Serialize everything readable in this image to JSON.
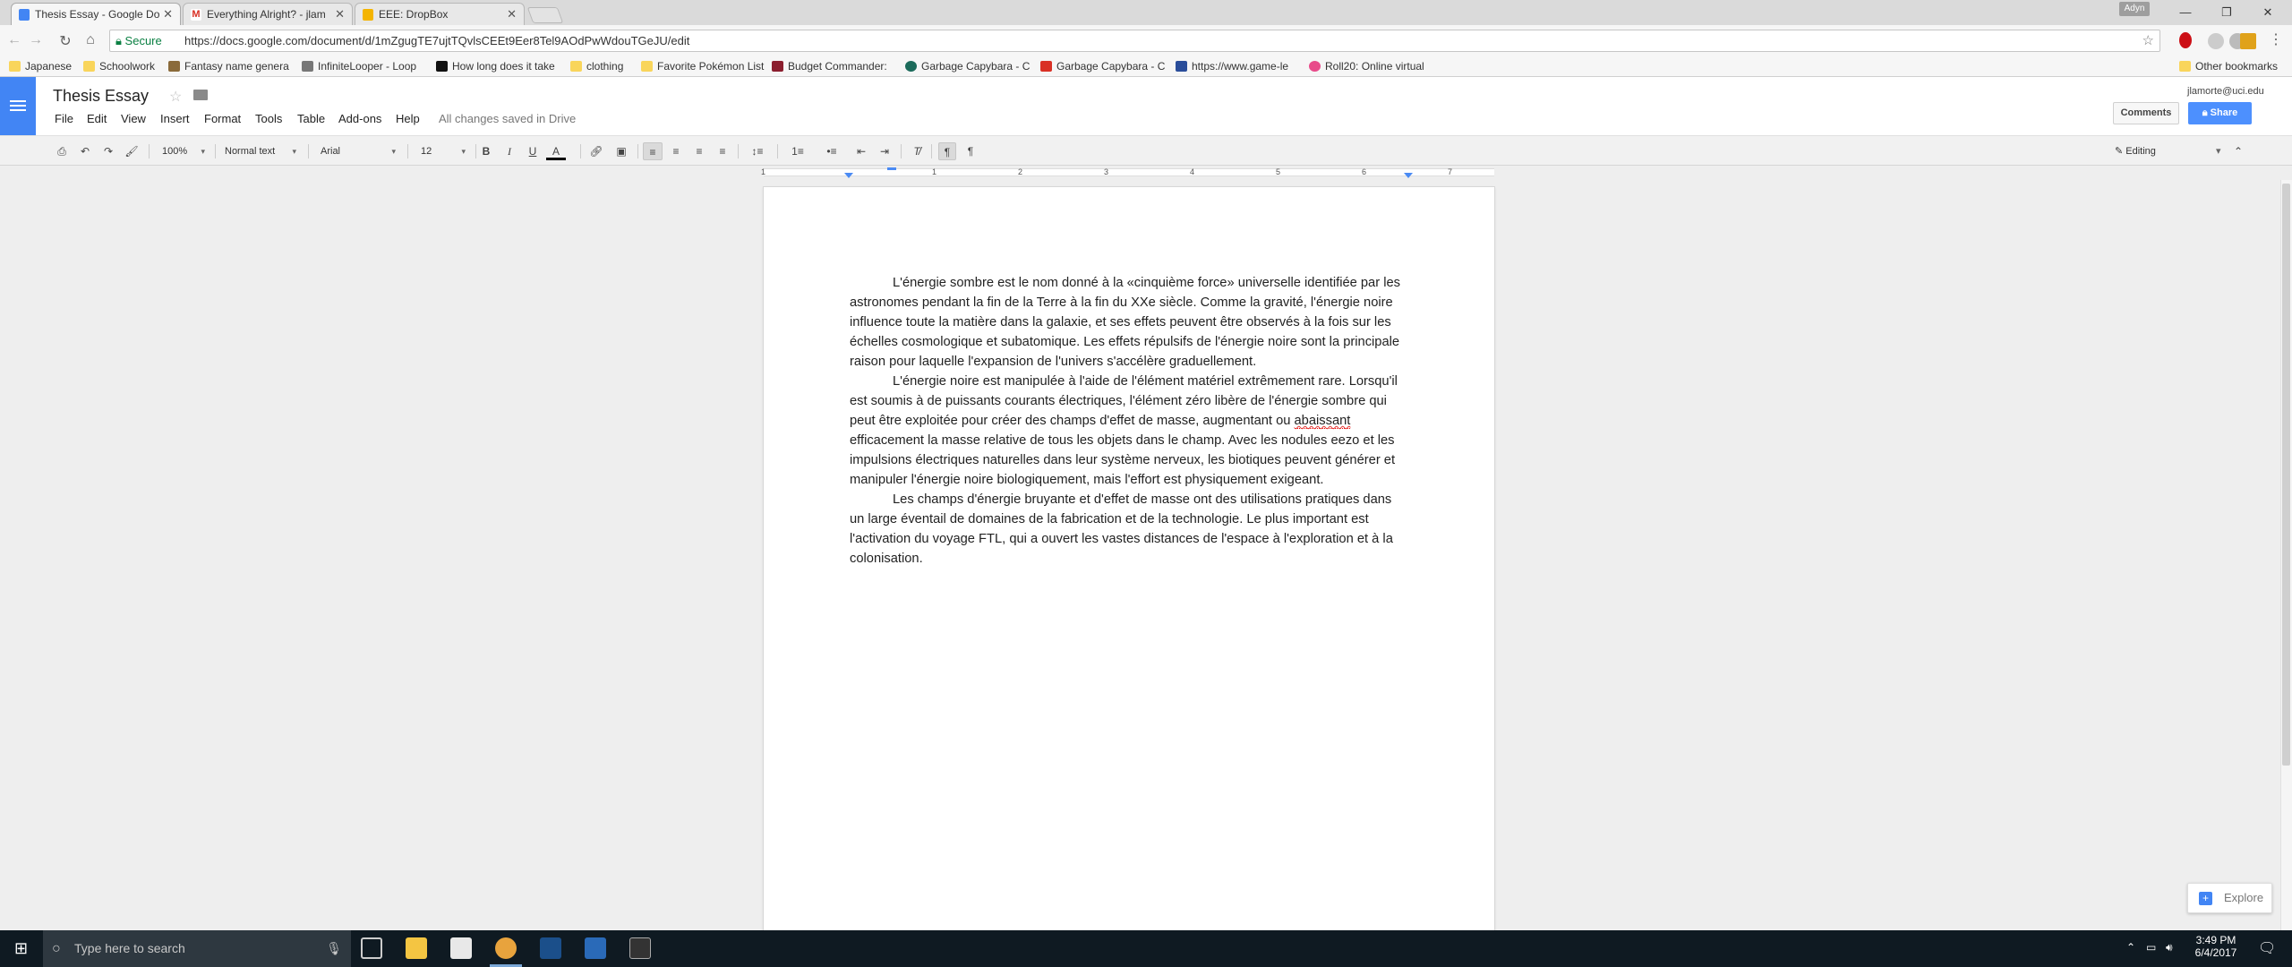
{
  "tabs": [
    {
      "title": "Thesis Essay - Google Do",
      "icon_color": "#4285f4"
    },
    {
      "title": "Everything Alright? - jlam",
      "icon_color": "#d93025"
    },
    {
      "title": "EEE: DropBox",
      "icon_color": "#f4b400"
    }
  ],
  "window": {
    "profile": "Adyn",
    "minimize": "—",
    "restore": "❐",
    "close": "✕"
  },
  "address": {
    "secure": "Secure",
    "url": "https://docs.google.com/document/d/1mZgugTE7ujtTQvlsCEEt9Eer8Tel9AOdPwWdouTGeJU/edit"
  },
  "bookmarks": [
    {
      "label": "Japanese",
      "color": "#f9d55b"
    },
    {
      "label": "Schoolwork",
      "color": "#f9d55b"
    },
    {
      "label": "Fantasy name genera",
      "color": "#8a6a3a"
    },
    {
      "label": "InfiniteLooper - Loop",
      "color": "#777777"
    },
    {
      "label": "How long does it take",
      "color": "#111111"
    },
    {
      "label": "clothing",
      "color": "#f9d55b"
    },
    {
      "label": "Favorite Pokémon List",
      "color": "#f9d55b"
    },
    {
      "label": "Budget Commander:",
      "color": "#8b1e2e"
    },
    {
      "label": "Garbage Capybara - C",
      "color": "#1b6a5a"
    },
    {
      "label": "Garbage Capybara - C",
      "color": "#d93025"
    },
    {
      "label": "https://www.game-le",
      "color": "#2a4d9a"
    },
    {
      "label": "Roll20: Online virtual",
      "color": "#e84a8a"
    }
  ],
  "other_bookmarks": "Other bookmarks",
  "doc": {
    "title": "Thesis Essay",
    "menus": [
      "File",
      "Edit",
      "View",
      "Insert",
      "Format",
      "Tools",
      "Table",
      "Add-ons",
      "Help"
    ],
    "saved": "All changes saved in Drive",
    "account": "jlamorte@uci.edu",
    "comments": "Comments",
    "share": "Share"
  },
  "format": {
    "zoom": "100%",
    "style": "Normal text",
    "font": "Arial",
    "size": "12",
    "mode": "Editing"
  },
  "ruler": [
    "1",
    "1",
    "2",
    "3",
    "4",
    "5",
    "6",
    "7"
  ],
  "paragraphs": [
    {
      "text": "L'énergie sombre est le nom donné à la «cinquième force» universelle identifiée par les astronomes pendant la fin de la Terre à la fin du XXe siècle. Comme la gravité, l'énergie noire influence toute la matière dans la galaxie, et ses effets peuvent être observés à la fois sur les échelles cosmologique et subatomique. Les effets répulsifs de l'énergie noire sont la principale raison pour laquelle l'expansion de l'univers s'accélère graduellement."
    },
    {
      "before": "L'énergie noire est manipulée à l'aide de l'élément matériel extrêmement rare. Lorsqu'il est soumis à de puissants courants électriques, l'élément zéro libère de l'énergie sombre qui peut être exploitée pour créer des champs d'effet de masse, augmentant ou ",
      "misspelled": "abaissant",
      "after": " efficacement la masse relative de tous les objets dans le champ. Avec les nodules eezo et les impulsions électriques naturelles dans leur système nerveux, les biotiques peuvent générer et manipuler l'énergie noire biologiquement, mais l'effort est physiquement exigeant."
    },
    {
      "text": "Les champs d'énergie bruyante et d'effet de masse ont des utilisations pratiques dans un large éventail de domaines de la fabrication et de la technologie. Le plus important est l'activation du voyage FTL, qui a ouvert les vastes distances de l'espace à l'exploration et à la colonisation."
    }
  ],
  "explore": "Explore",
  "taskbar": {
    "search_placeholder": "Type here to search",
    "time": "3:49 PM",
    "date": "6/4/2017"
  }
}
